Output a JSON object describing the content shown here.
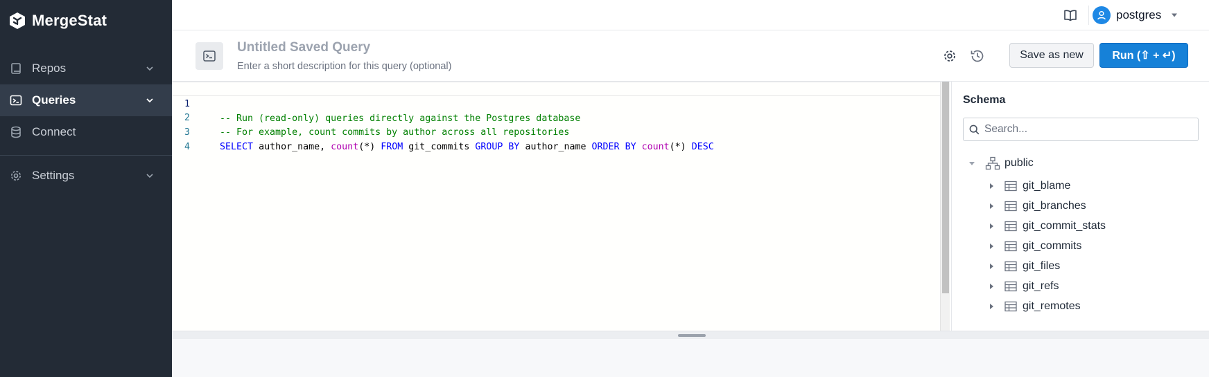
{
  "app": {
    "name": "MergeStat"
  },
  "sidebar": {
    "items": [
      {
        "label": "Repos",
        "icon": "book-icon",
        "expandable": true,
        "active": false
      },
      {
        "label": "Queries",
        "icon": "terminal-icon",
        "expandable": true,
        "active": true
      },
      {
        "label": "Connect",
        "icon": "database-icon",
        "expandable": false,
        "active": false
      },
      {
        "label": "Settings",
        "icon": "gear-icon",
        "expandable": true,
        "active": false
      }
    ]
  },
  "topbar": {
    "user": "postgres"
  },
  "query": {
    "title": "Untitled Saved Query",
    "description_placeholder": "Enter a short description for this query (optional)",
    "save_label": "Save as new",
    "run_label": "Run (⇧ + ↵)"
  },
  "editor": {
    "lines": [
      {
        "number": "1",
        "text": "-- Run (read-only) queries directly against the Postgres database"
      },
      {
        "number": "2",
        "text": "-- For example, count commits by author across all repositories"
      },
      {
        "number": "3",
        "text": "SELECT author_name, count(*) FROM git_commits GROUP BY author_name ORDER BY count(*) DESC"
      },
      {
        "number": "4",
        "text": ""
      }
    ]
  },
  "schema": {
    "title": "Schema",
    "search_placeholder": "Search...",
    "root": "public",
    "tables": [
      "git_blame",
      "git_branches",
      "git_commit_stats",
      "git_commits",
      "git_files",
      "git_refs",
      "git_remotes"
    ]
  },
  "colors": {
    "sidebar_bg": "#232b36",
    "accent": "#1681d8",
    "comment": "#008000",
    "keyword": "#0000ff",
    "function": "#b000b0"
  }
}
